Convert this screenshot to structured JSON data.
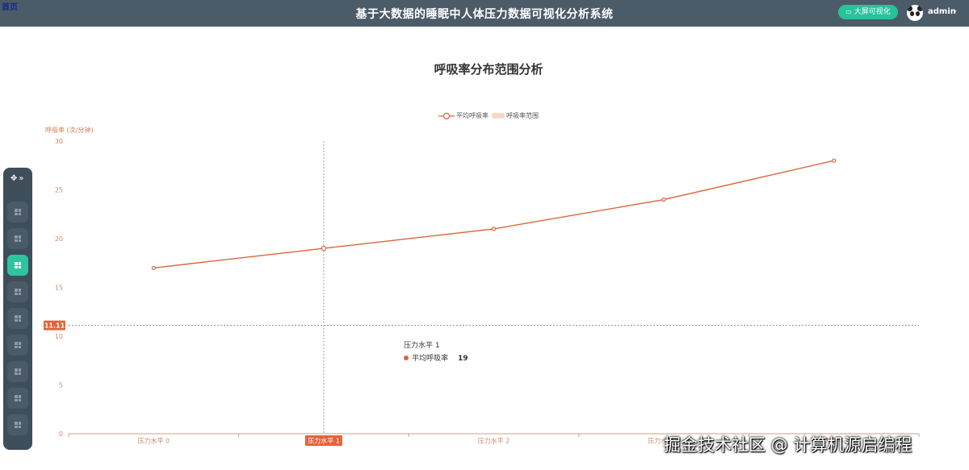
{
  "header": {
    "logo_text": "首页",
    "title": "基于大数据的睡眠中人体压力数据可视化分析系统",
    "bigscreen_label": "大屏可视化",
    "username": "admin"
  },
  "sidebar": {
    "items": [
      {
        "icon": "grid-icon",
        "active": false
      },
      {
        "icon": "grid-icon",
        "active": false
      },
      {
        "icon": "grid-icon",
        "active": true
      },
      {
        "icon": "grid-icon",
        "active": false
      },
      {
        "icon": "grid-icon",
        "active": false
      },
      {
        "icon": "grid-icon",
        "active": false
      },
      {
        "icon": "grid-icon",
        "active": false
      },
      {
        "icon": "grid-icon",
        "active": false
      },
      {
        "icon": "grid-icon",
        "active": false
      }
    ]
  },
  "chart_data": {
    "type": "line",
    "title": "呼吸率分布范围分析",
    "ylabel": "呼吸率 (次/分钟)",
    "categories": [
      "压力水平 0",
      "压力水平 1",
      "压力水平 2",
      "压力水平 3",
      "压力水平 4"
    ],
    "series": [
      {
        "name": "平均呼吸率",
        "values": [
          17,
          19,
          21,
          24,
          28
        ],
        "color": "#d9663a"
      },
      {
        "name": "呼吸率范围",
        "values": [],
        "color": "#f5d9c8"
      }
    ],
    "ylim": [
      0,
      30
    ],
    "yticks": [
      0,
      5,
      10,
      15,
      20,
      25,
      30
    ],
    "grid": false,
    "legend": "top-center",
    "pointer": {
      "category": "压力水平 1",
      "y_value": "11.11"
    },
    "tooltip": {
      "title": "压力水平 1",
      "series": "平均呼吸率",
      "value": "19"
    }
  },
  "watermark": "掘金技术社区 @ 计算机源启编程"
}
